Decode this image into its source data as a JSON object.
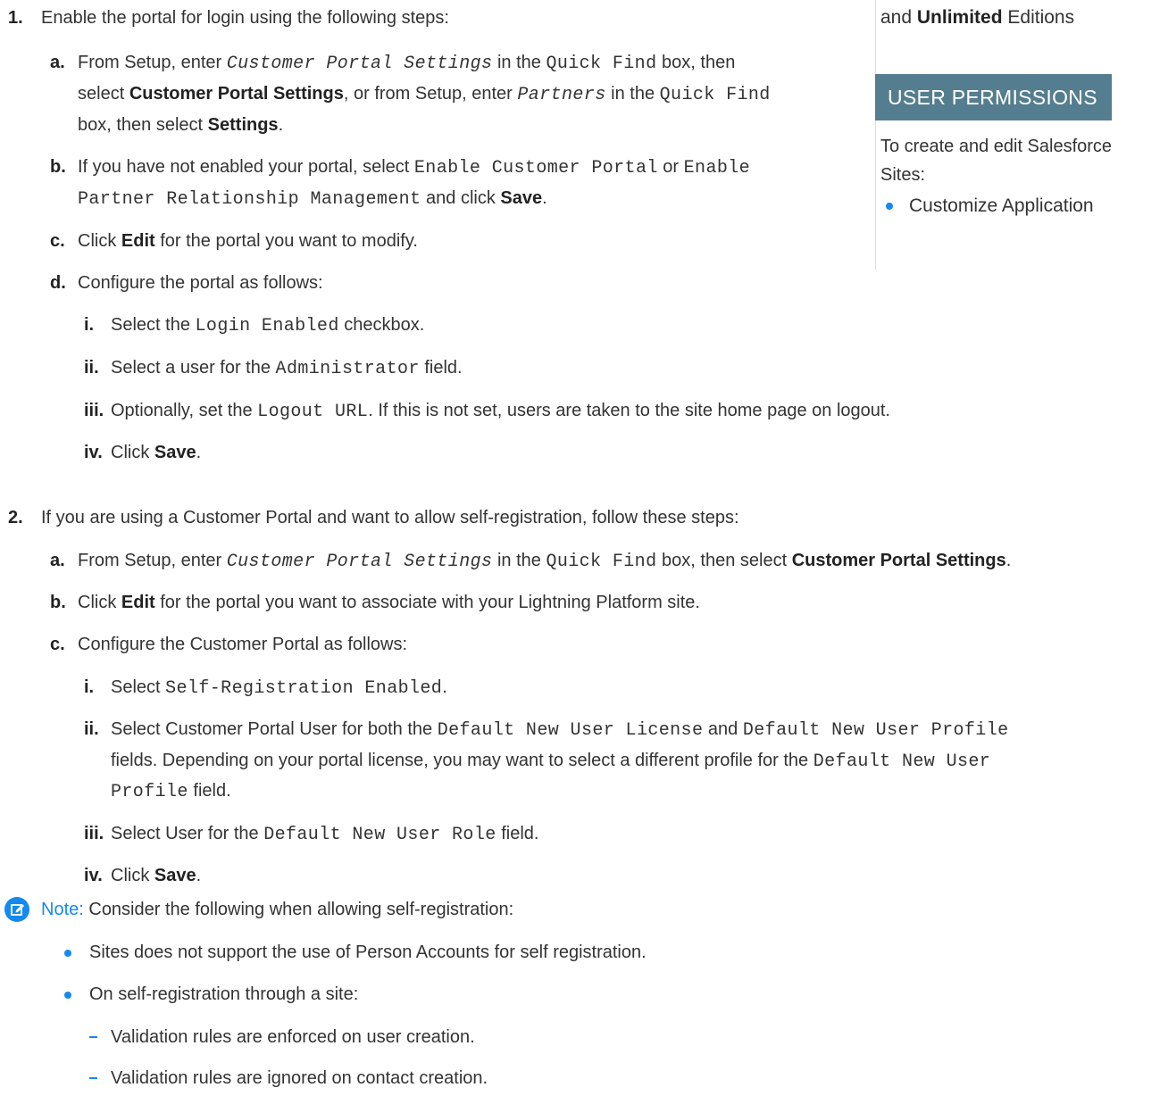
{
  "sidebar": {
    "editions_prefix": "and ",
    "editions_bold": "Unlimited",
    "editions_suffix": " Editions",
    "permissions_heading": "USER PERMISSIONS",
    "permission_desc_line1": "To create and edit Salesforce",
    "permission_desc_line2": "Sites:",
    "permission_item": "Customize Application"
  },
  "step1": {
    "number": "1.",
    "intro": "Enable the portal for login using the following steps:",
    "a": {
      "letter": "a.",
      "t1": "From Setup, enter ",
      "c1": "Customer Portal Settings",
      "t2": " in the ",
      "c2": "Quick Find",
      "t3": " box, then",
      "t4": "select ",
      "b1": "Customer Portal Settings",
      "t5": ", or from Setup, enter ",
      "c3": "Partners",
      "t6": " in the ",
      "c4": "Quick Find",
      "t7": "box, then select ",
      "b2": "Settings",
      "t8": "."
    },
    "b": {
      "letter": "b.",
      "t1": "If you have not enabled your portal, select ",
      "c1": "Enable Customer Portal",
      "t2": " or ",
      "c2": "Enable",
      "c3": "Partner Relationship Management",
      "t3": " and click ",
      "b1": "Save",
      "t4": "."
    },
    "c": {
      "letter": "c.",
      "t1": "Click ",
      "b1": "Edit",
      "t2": " for the portal you want to modify."
    },
    "d": {
      "letter": "d.",
      "t1": "Configure the portal as follows:",
      "i": {
        "num": "i.",
        "t1": "Select the ",
        "c1": "Login Enabled",
        "t2": " checkbox."
      },
      "ii": {
        "num": "ii.",
        "t1": "Select a user for the ",
        "c1": "Administrator",
        "t2": " field."
      },
      "iii": {
        "num": "iii.",
        "t1": "Optionally, set the ",
        "c1": "Logout URL",
        "t2": ". If this is not set, users are taken to the site home page on logout."
      },
      "iv": {
        "num": "iv.",
        "t1": "Click ",
        "b1": "Save",
        "t2": "."
      }
    }
  },
  "step2": {
    "number": "2.",
    "intro": "If you are using a Customer Portal and want to allow self-registration, follow these steps:",
    "a": {
      "letter": "a.",
      "t1": "From Setup, enter ",
      "c1": "Customer Portal Settings",
      "t2": " in the ",
      "c2": "Quick Find",
      "t3": " box, then select ",
      "b1": "Customer Portal Settings",
      "t4": "."
    },
    "b": {
      "letter": "b.",
      "t1": "Click ",
      "b1": "Edit",
      "t2": " for the portal you want to associate with your Lightning Platform site."
    },
    "c": {
      "letter": "c.",
      "t1": "Configure the Customer Portal as follows:",
      "i": {
        "num": "i.",
        "t1": "Select ",
        "c1": "Self-Registration Enabled",
        "t2": "."
      },
      "ii": {
        "num": "ii.",
        "t1": "Select Customer Portal User for both the ",
        "c1": "Default New User License",
        "t2": " and ",
        "c2": "Default New User Profile",
        "t3": "fields. Depending on your portal license, you may want to select a different profile for the ",
        "c3": "Default New User",
        "c4": "Profile",
        "t4": " field."
      },
      "iii": {
        "num": "iii.",
        "t1": "Select User for the ",
        "c1": "Default New User Role",
        "t2": " field."
      },
      "iv": {
        "num": "iv.",
        "t1": "Click ",
        "b1": "Save",
        "t2": "."
      }
    }
  },
  "note": {
    "label": "Note:",
    "intro": " Consider the following when allowing self-registration:",
    "bullet1": "Sites does not support the use of Person Accounts for self registration.",
    "bullet2": "On self-registration through a site:",
    "sub1": "Validation rules are enforced on user creation.",
    "sub2": "Validation rules are ignored on contact creation."
  },
  "colors": {
    "accent": "#1589ee",
    "badge": "#547e8f",
    "text": "#333333"
  }
}
